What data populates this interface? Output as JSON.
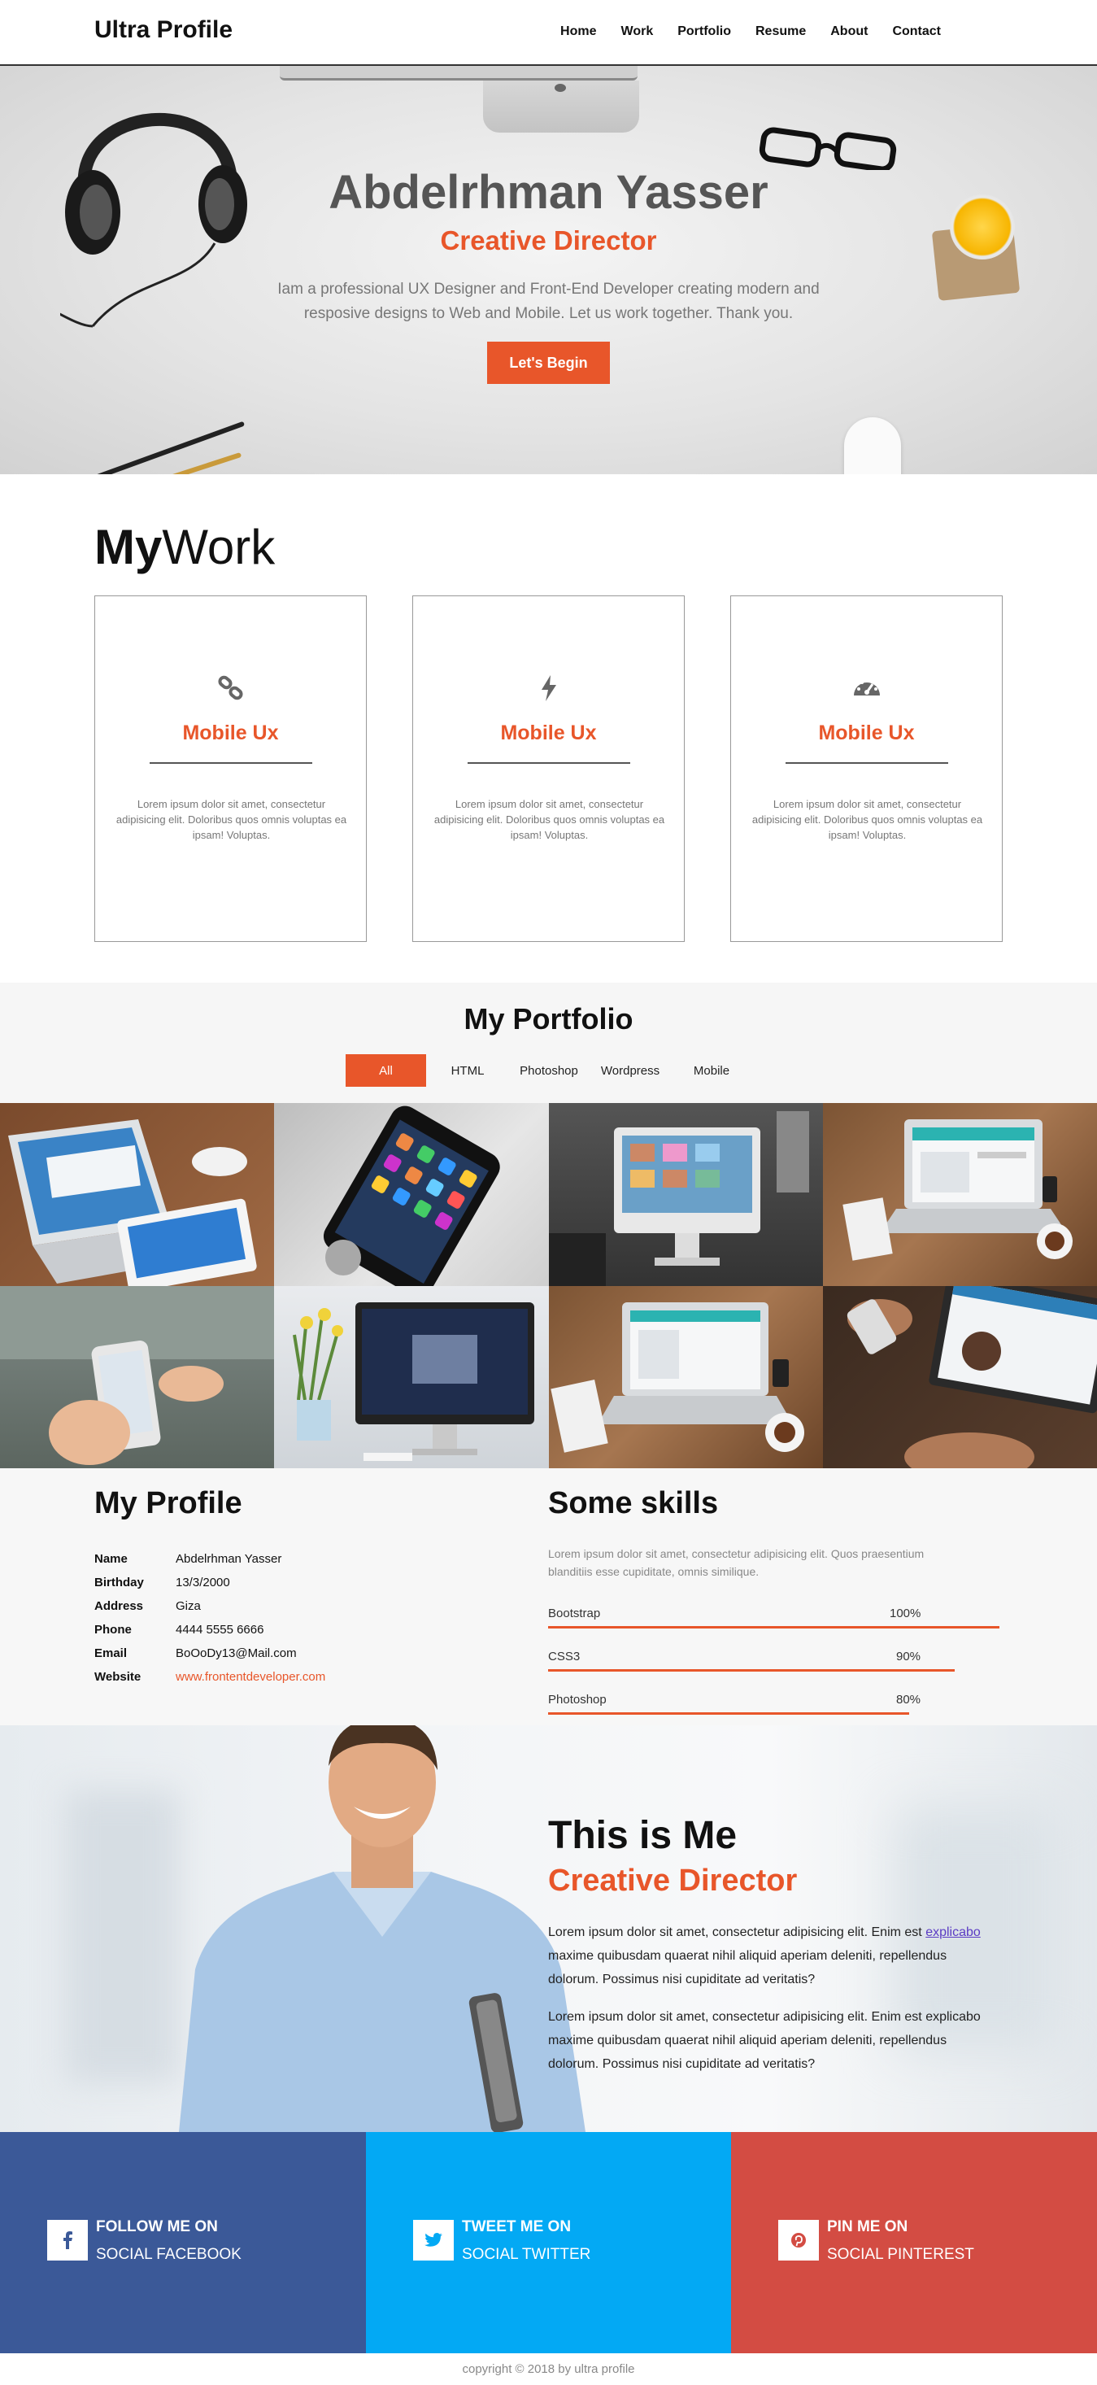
{
  "nav": {
    "brand": "Ultra Profile",
    "links": [
      "Home",
      "Work",
      "Portfolio",
      "Resume",
      "About",
      "Contact"
    ]
  },
  "hero": {
    "name": "Abdelrhman Yasser",
    "role": "Creative Director",
    "description": "Iam a professional UX Designer and Front-End Developer creating modern and resposive designs to Web and Mobile. Let us work together. Thank you.",
    "button": "Let's Begin"
  },
  "work": {
    "title_bold": "My",
    "title_rest": "Work",
    "cards": [
      {
        "icon": "link-icon",
        "title": "Mobile Ux",
        "text": "Lorem ipsum dolor sit amet, consectetur adipisicing elit. Doloribus quos omnis voluptas ea ipsam! Voluptas."
      },
      {
        "icon": "bolt-icon",
        "title": "Mobile Ux",
        "text": "Lorem ipsum dolor sit amet, consectetur adipisicing elit. Doloribus quos omnis voluptas ea ipsam! Voluptas."
      },
      {
        "icon": "dashboard-icon",
        "title": "Mobile Ux",
        "text": "Lorem ipsum dolor sit amet, consectetur adipisicing elit. Doloribus quos omnis voluptas ea ipsam! Voluptas."
      }
    ]
  },
  "portfolio": {
    "title_light": "My",
    "title_bold": "Portfolio",
    "filters": [
      "All",
      "HTML",
      "Photoshop",
      "Wordpress",
      "Mobile"
    ],
    "active_filter": "All"
  },
  "profile": {
    "title_light": "My",
    "title_bold": "Profile",
    "rows": [
      {
        "key": "Name",
        "value": "Abdelrhman Yasser"
      },
      {
        "key": "Birthday",
        "value": "13/3/2000"
      },
      {
        "key": "Address",
        "value": "Giza"
      },
      {
        "key": "Phone",
        "value": "4444 5555 6666"
      },
      {
        "key": "Email",
        "value": "BoOoDy13@Mail.com"
      },
      {
        "key": "Website",
        "value": "www.frontentdeveloper.com"
      }
    ]
  },
  "skills": {
    "title_bold": "Some",
    "title_light": "skills",
    "description": "Lorem ipsum dolor sit amet, consectetur adipisicing elit. Quos praesentium blanditiis esse cupiditate, omnis similique.",
    "items": [
      {
        "name": "Bootstrap",
        "percent_label": "100%",
        "value": 100
      },
      {
        "name": "CSS3",
        "percent_label": "90%",
        "value": 90
      },
      {
        "name": "Photoshop",
        "percent_label": "80%",
        "value": 80
      }
    ]
  },
  "about": {
    "title_light": "This is",
    "title_bold": "Me",
    "role": "Creative Director",
    "p1_before": "Lorem ipsum dolor sit amet, consectetur adipisicing elit. Enim est ",
    "p1_link": "explicabo",
    "p1_after": " maxime quibusdam quaerat nihil aliquid aperiam deleniti, repellendus dolorum. Possimus nisi cupiditate ad veritatis?",
    "p2": "Lorem ipsum dolor sit amet, consectetur adipisicing elit. Enim est explicabo maxime quibusdam quaerat nihil aliquid aperiam deleniti, repellendus dolorum. Possimus nisi cupiditate ad veritatis?"
  },
  "social": [
    {
      "icon": "facebook-icon",
      "line1": "FOLLOW ME ON",
      "line2": "SOCIAL FACEBOOK",
      "color": "#3b5998"
    },
    {
      "icon": "twitter-icon",
      "line1": "TWEET ME ON",
      "line2": "SOCIAL TWITTER",
      "color": "#03a9f4"
    },
    {
      "icon": "pinterest-icon",
      "line1": "PIN ME ON",
      "line2": "SOCIAL PINTEREST",
      "color": "#d34c43"
    }
  ],
  "footer": "copyright © 2018 by ultra profile",
  "colors": {
    "accent": "#e8562a"
  }
}
